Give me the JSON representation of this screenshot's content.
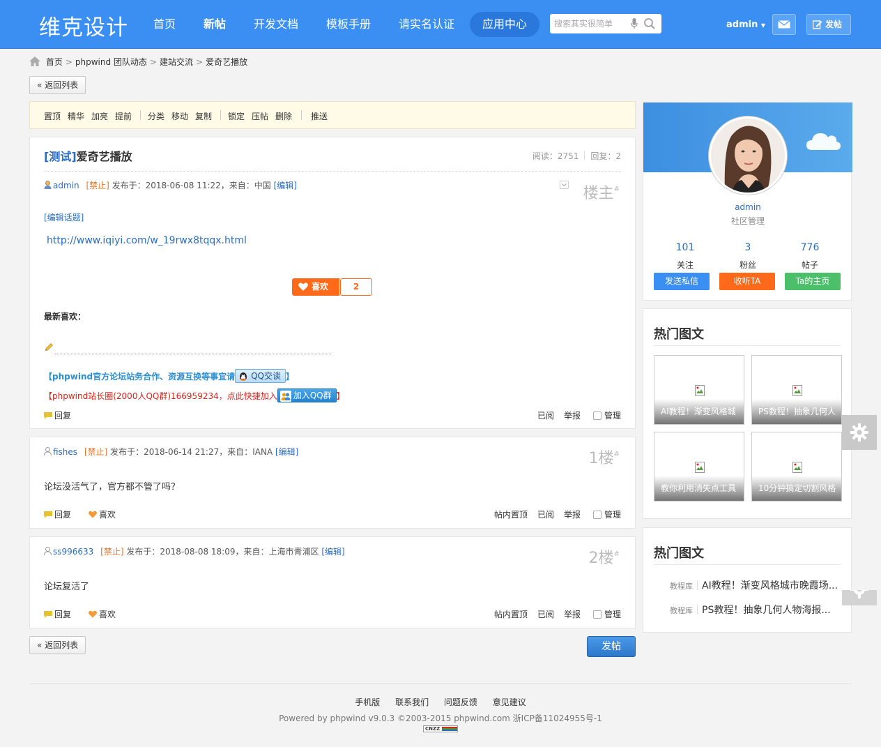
{
  "header": {
    "logo": "维克设计",
    "nav": [
      "首页",
      "新帖",
      "开发文档",
      "模板手册",
      "请实名认证",
      "应用中心"
    ],
    "search_placeholder": "搜索其实很简单",
    "username": "admin",
    "post_label": "发帖"
  },
  "breadcrumb": [
    "首页",
    "phpwind 团队动态",
    "建站交流",
    "爱奇艺播放"
  ],
  "back_label": "« 返回列表",
  "toolbar": [
    "置顶",
    "精华",
    "加亮",
    "提前",
    "分类",
    "移动",
    "复制",
    "锁定",
    "压帖",
    "删除",
    "推送"
  ],
  "thread": {
    "tag": "[测试]",
    "title": "爱奇艺播放",
    "views_label": "阅读：2751",
    "replies_label": "回复：2",
    "author": "admin",
    "ban": "[禁止]",
    "meta": "发布于：2018-06-08 11:22，来自：中国",
    "edit": "[编辑]",
    "floor": "楼主",
    "floor_mark": "#",
    "edit_topic": "[编辑话题]",
    "url": "http://www.iqiyi.com/w_19rwx8tqqx.html",
    "like_label": "喜欢",
    "like_count": "2",
    "latest_likes": "最新喜欢：",
    "sig1_pre": "【",
    "sig1_text": "phpwind官方论坛站务合作、资源互换等事宜请",
    "sig1_badge": "QQ交谈",
    "sig1_post": "】",
    "sig2_pre": "【",
    "sig2_text": "phpwind站长圈(2000人QQ群)166959234，点此快捷加入",
    "sig2_badge": "加入QQ群",
    "sig2_post": "】",
    "reply": "回复",
    "read": "已阅",
    "report": "举报",
    "manage": "管理"
  },
  "replies": [
    {
      "author": "fishes",
      "ban": "[禁止]",
      "meta": "发布于：2018-06-14 21:27，来自：IANA",
      "edit": "[编辑]",
      "floor": "1楼",
      "floor_mark": "#",
      "content": "论坛没活气了，官方都不管了吗？",
      "reply": "回复",
      "like": "喜欢",
      "top": "帖内置顶",
      "read": "已阅",
      "report": "举报",
      "manage": "管理"
    },
    {
      "author": "ss996633",
      "ban": "[禁止]",
      "meta": "发布于：2018-08-08 18:09，来自：上海市青浦区",
      "edit": "[编辑]",
      "floor": "2楼",
      "floor_mark": "#",
      "content": "论坛复活了",
      "reply": "回复",
      "like": "喜欢",
      "top": "帖内置顶",
      "read": "已阅",
      "report": "举报",
      "manage": "管理"
    }
  ],
  "post_button": "发帖",
  "profile": {
    "name": "admin",
    "role": "社区管理",
    "stats": [
      {
        "num": "101",
        "label": "关注"
      },
      {
        "num": "3",
        "label": "粉丝"
      },
      {
        "num": "776",
        "label": "帖子"
      }
    ],
    "buttons": [
      "发送私信",
      "收听TA",
      "Ta的主页"
    ],
    "button_colors": [
      "#3b8ff2",
      "#ff6a1a",
      "#4cbf6a"
    ]
  },
  "hot_images": {
    "title": "热门图文",
    "items": [
      "AI教程！渐变风格城",
      "PS教程！抽象几何人",
      "教你利用消失点工具",
      "10分钟搞定切割风格"
    ]
  },
  "hot_list": {
    "title": "热门图文",
    "items": [
      {
        "cat": "教程库",
        "title": "AI教程！渐变风格城市晚霞场..."
      },
      {
        "cat": "教程库",
        "title": "PS教程！抽象几何人物海报..."
      }
    ]
  },
  "footer": {
    "links": [
      "手机版",
      "联系我们",
      "问题反馈",
      "意见建议"
    ],
    "copyright": "Powered by phpwind v9.0.3 ©2003-2015 phpwind.com 浙ICP备11024955号-1",
    "badge": "CNZZ"
  }
}
